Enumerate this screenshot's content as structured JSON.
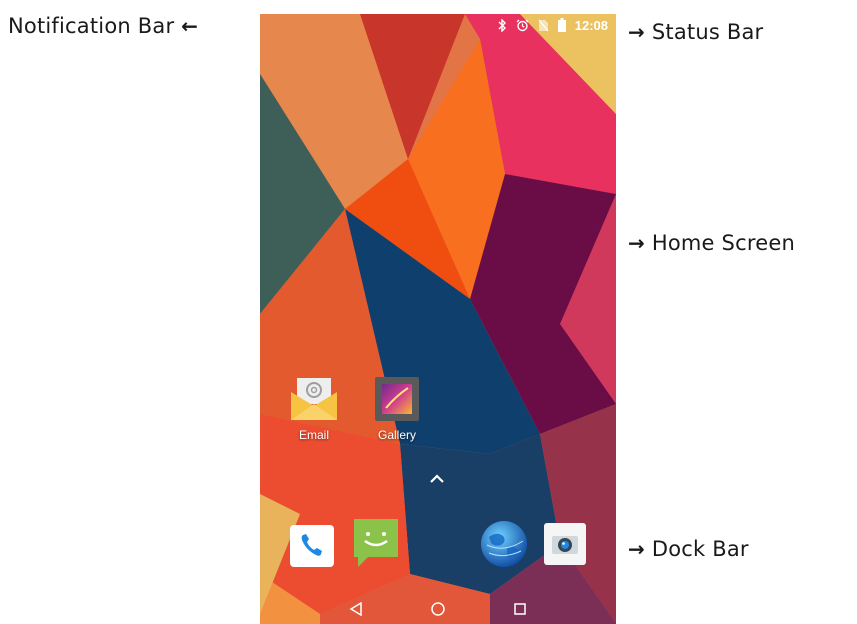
{
  "callouts": {
    "notification_bar": "Notification Bar",
    "status_bar": "Status Bar",
    "home_screen": "Home Screen",
    "dock_bar": "Dock Bar",
    "arrow_left": "🡐",
    "arrow_right": "➔"
  },
  "status_bar": {
    "time": "12:08",
    "icons": [
      "bluetooth-icon",
      "alarm-icon",
      "no-sim-icon",
      "battery-icon"
    ]
  },
  "home_screen": {
    "apps": [
      {
        "label": "Email",
        "icon": "email-icon"
      },
      {
        "label": "Gallery",
        "icon": "gallery-icon"
      }
    ],
    "app_drawer_icon": "chevron-up-icon"
  },
  "dock": {
    "icons": [
      "phone-icon",
      "messaging-icon",
      "browser-icon",
      "camera-icon"
    ]
  },
  "nav_bar": {
    "buttons": [
      "back-icon",
      "home-icon",
      "recents-icon"
    ]
  },
  "colors": {
    "dock_phone_bg": "#ffffff",
    "phone_glyph": "#1e88e5",
    "messaging_bg": "#8bc34a",
    "email_envelope": "#f6c343"
  }
}
